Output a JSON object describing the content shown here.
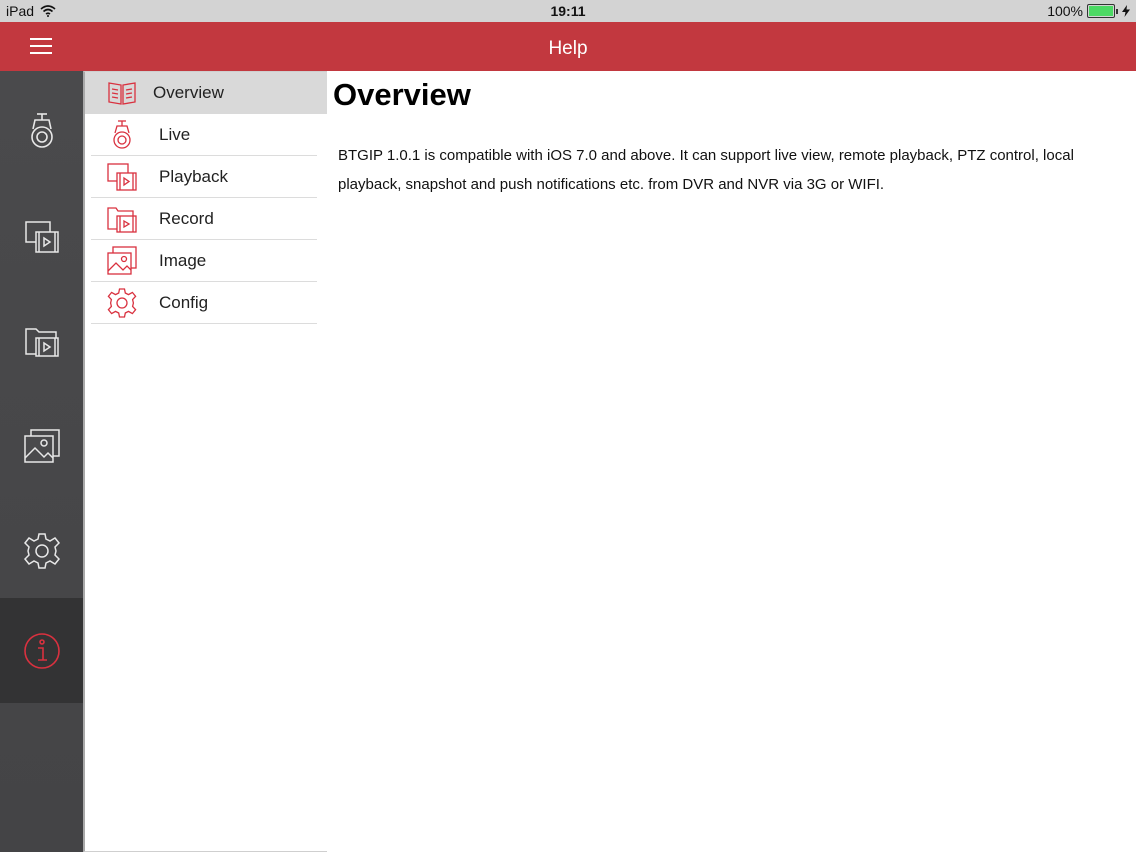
{
  "status_bar": {
    "device": "iPad",
    "time": "19:11",
    "battery": "100%",
    "wifi_icon": "wifi-icon",
    "battery_level": 1.0
  },
  "header": {
    "title": "Help",
    "menu_icon": "hamburger-menu-icon"
  },
  "side_rail": [
    {
      "icon": "camera-icon",
      "active": false
    },
    {
      "icon": "playback-icon",
      "active": false
    },
    {
      "icon": "record-folder-icon",
      "active": false
    },
    {
      "icon": "image-icon",
      "active": false
    },
    {
      "icon": "gear-icon",
      "active": false
    },
    {
      "icon": "info-icon",
      "active": true
    }
  ],
  "help_menu": {
    "items": [
      {
        "label": "Overview",
        "icon": "book-icon",
        "selected": true
      },
      {
        "label": "Live",
        "icon": "camera-icon",
        "selected": false
      },
      {
        "label": "Playback",
        "icon": "playback-icon",
        "selected": false
      },
      {
        "label": "Record",
        "icon": "record-folder-icon",
        "selected": false
      },
      {
        "label": "Image",
        "icon": "image-icon",
        "selected": false
      },
      {
        "label": "Config",
        "icon": "gear-icon",
        "selected": false
      }
    ]
  },
  "content": {
    "heading": "Overview",
    "body": "BTGIP 1.0.1 is compatible with iOS 7.0 and above. It can support live view, remote playback, PTZ control, local playback, snapshot and push notifications etc. from DVR and NVR via 3G or WIFI."
  },
  "colors": {
    "brand": "#c2383f",
    "accent_icon": "#d9313f",
    "rail_background": "#4a4a4c",
    "selected_row": "#d9d9d9"
  }
}
